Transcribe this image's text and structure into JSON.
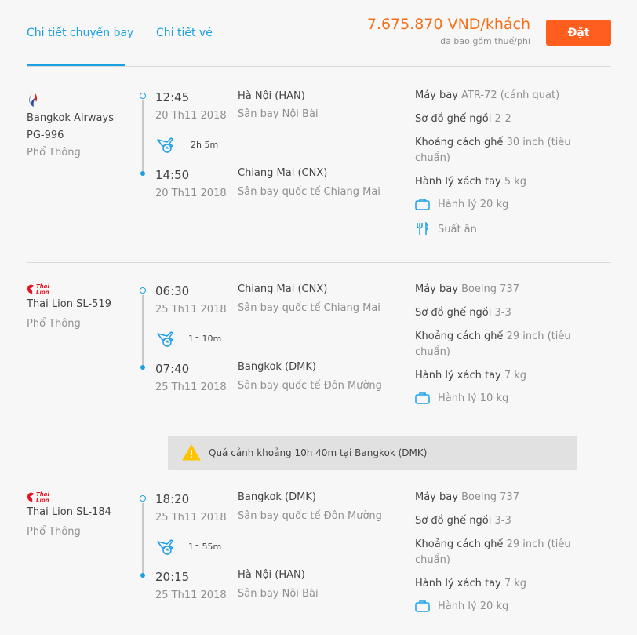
{
  "tabs": {
    "flight_details": "Chi tiết chuyến bay",
    "ticket_details": "Chi tiết vé"
  },
  "price": {
    "amount": "7.675.870 VND/khách",
    "note": "đã bao gồm thuế/phí"
  },
  "book_button": "Đặt",
  "segments": [
    {
      "airline": "Bangkok Airways",
      "flight_no": "PG-996",
      "cabin": "Phổ Thông",
      "logo_icon": "bangkok-airways-logo",
      "dep_time": "12:45",
      "dep_date": "20 Th11 2018",
      "dep_city": "Hà Nội (HAN)",
      "dep_airport": "Sân bay Nội Bài",
      "duration": "2h 5m",
      "arr_time": "14:50",
      "arr_date": "20 Th11 2018",
      "arr_city": "Chiang Mai (CNX)",
      "arr_airport": "Sân bay quốc tế Chiang Mai",
      "aircraft_label": "Máy bay",
      "aircraft": "ATR-72 (cánh quạt)",
      "seat_layout_label": "Sơ đồ ghế ngồi",
      "seat_layout": "2-2",
      "seat_pitch_label": "Khoảng cách ghế",
      "seat_pitch": "30 inch (tiêu chuẩn)",
      "cabin_bag_label": "Hành lý xách tay",
      "cabin_bag": "5 kg",
      "baggage": "Hành lý 20 kg",
      "meal": "Suất ăn"
    },
    {
      "airline": "Thai Lion",
      "flight_no": "SL-519",
      "cabin": "Phổ Thông",
      "logo_icon": "thai-lion-logo",
      "dep_time": "06:30",
      "dep_date": "25 Th11 2018",
      "dep_city": "Chiang Mai (CNX)",
      "dep_airport": "Sân bay quốc tế Chiang Mai",
      "duration": "1h 10m",
      "arr_time": "07:40",
      "arr_date": "25 Th11 2018",
      "arr_city": "Bangkok (DMK)",
      "arr_airport": "Sân bay quốc tế Đôn Mường",
      "aircraft_label": "Máy bay",
      "aircraft": "Boeing 737",
      "seat_layout_label": "Sơ đồ ghế ngồi",
      "seat_layout": "3-3",
      "seat_pitch_label": "Khoảng cách ghế",
      "seat_pitch": "29 inch (tiêu chuẩn)",
      "cabin_bag_label": "Hành lý xách tay",
      "cabin_bag": "7 kg",
      "baggage": "Hành lý 10 kg"
    },
    {
      "airline": "Thai Lion",
      "flight_no": "SL-184",
      "cabin": "Phổ Thông",
      "logo_icon": "thai-lion-logo",
      "dep_time": "18:20",
      "dep_date": "25 Th11 2018",
      "dep_city": "Bangkok (DMK)",
      "dep_airport": "Sân bay quốc tế Đôn Mường",
      "duration": "1h 55m",
      "arr_time": "20:15",
      "arr_date": "25 Th11 2018",
      "arr_city": "Hà Nội (HAN)",
      "arr_airport": "Sân bay Nội Bài",
      "aircraft_label": "Máy bay",
      "aircraft": "Boeing 737",
      "seat_layout_label": "Sơ đồ ghế ngồi",
      "seat_layout": "3-3",
      "seat_pitch_label": "Khoảng cách ghế",
      "seat_pitch": "29 inch (tiêu chuẩn)",
      "cabin_bag_label": "Hành lý xách tay",
      "cabin_bag": "7 kg",
      "baggage": "Hành lý 20 kg"
    }
  ],
  "layover": {
    "text": "Quá cảnh khoảng 10h 40m tại Bangkok (DMK)",
    "icon": "warning-icon"
  },
  "colors": {
    "accent_blue": "#1ba0e2",
    "price_orange": "#f56f18",
    "button_orange": "#ff5e1f",
    "thai_lion_red": "#e4151f"
  }
}
